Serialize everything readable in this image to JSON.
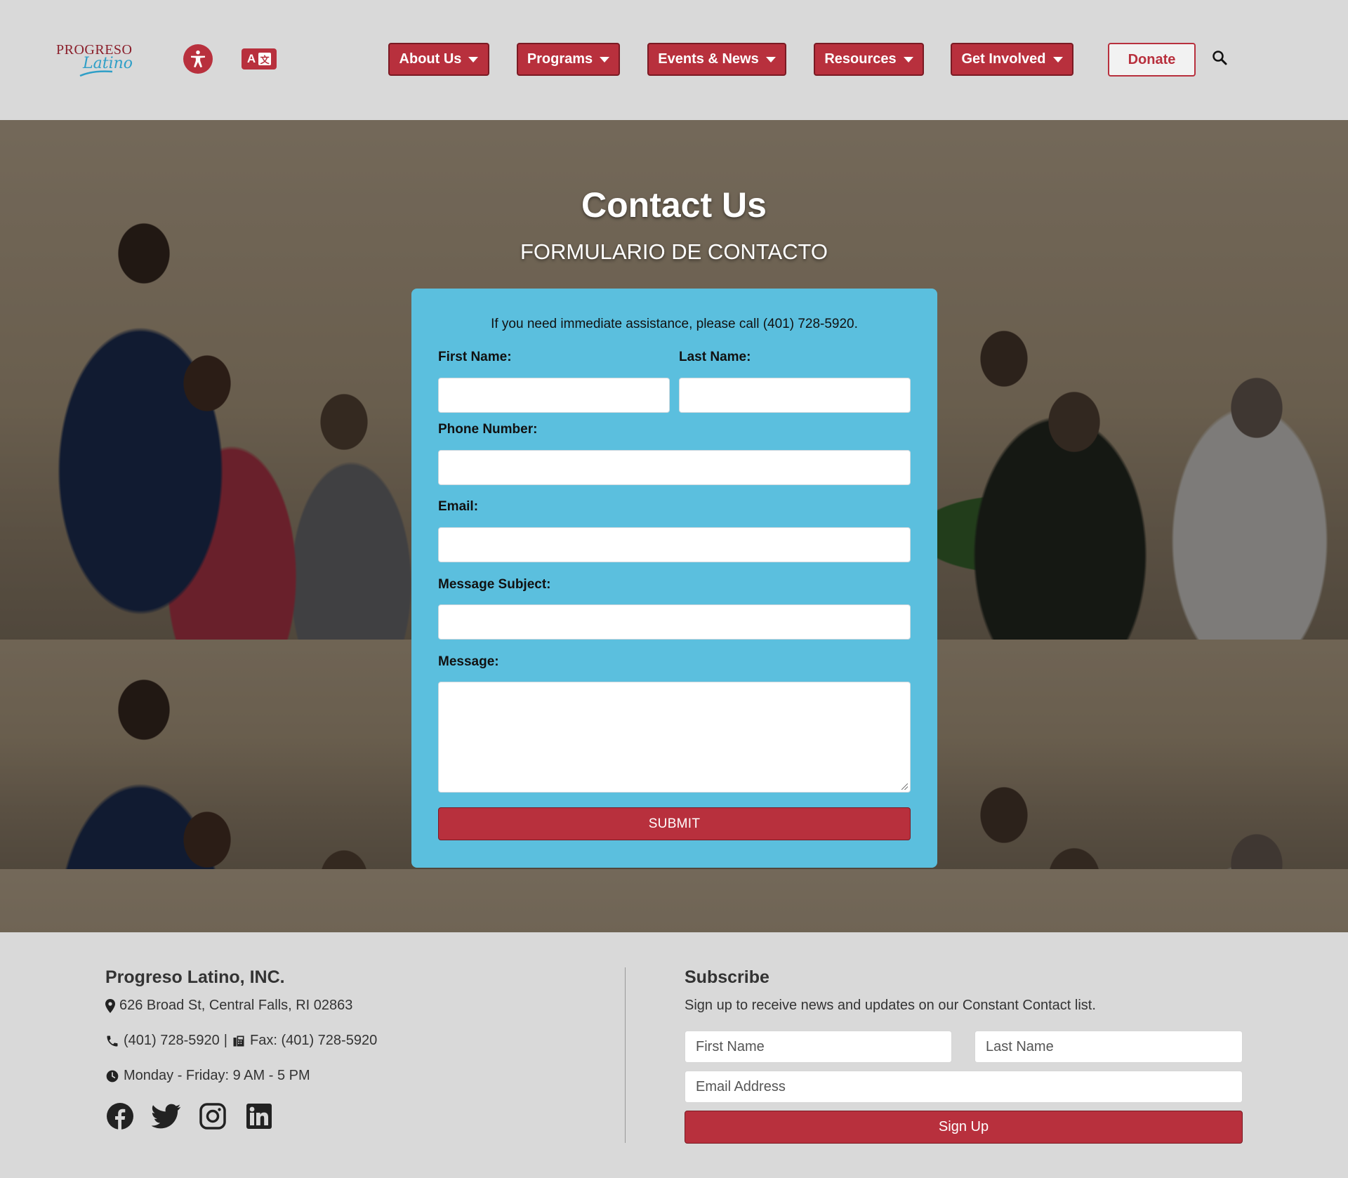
{
  "header": {
    "logo_text_top": "PROGRESO",
    "logo_text_bottom": "Latino",
    "nav": [
      {
        "label": "About Us"
      },
      {
        "label": "Programs"
      },
      {
        "label": "Events & News"
      },
      {
        "label": "Resources"
      },
      {
        "label": "Get Involved"
      }
    ],
    "donate_label": "Donate",
    "translate_label": "A",
    "translate_glyph": "文"
  },
  "hero": {
    "title": "Contact Us",
    "subtitle": "FORMULARIO DE CONTACTO"
  },
  "form": {
    "note": "If you need immediate assistance, please call (401) 728-5920.",
    "first_name_label": "First Name:",
    "last_name_label": "Last Name:",
    "phone_label": "Phone Number:",
    "email_label": "Email:",
    "subject_label": "Message Subject:",
    "message_label": "Message:",
    "submit_label": "SUBMIT"
  },
  "footer": {
    "org_name": "Progreso Latino, INC.",
    "address": "626 Broad St, Central Falls, RI 02863",
    "phone": "(401) 728-5920",
    "separator": "|",
    "fax": "Fax: (401) 728-5920",
    "hours": "Monday - Friday: 9 AM - 5 PM",
    "subscribe_title": "Subscribe",
    "subscribe_desc": "Sign up to receive news and updates on our Constant Contact list.",
    "first_name_placeholder": "First Name",
    "last_name_placeholder": "Last Name",
    "email_placeholder": "Email Address",
    "signup_label": "Sign Up",
    "socials": [
      "facebook",
      "twitter",
      "instagram",
      "linkedin"
    ]
  },
  "colors": {
    "brand_red": "#b8303d",
    "form_blue": "#5bbfde",
    "background_gray": "#d9d9d9"
  }
}
